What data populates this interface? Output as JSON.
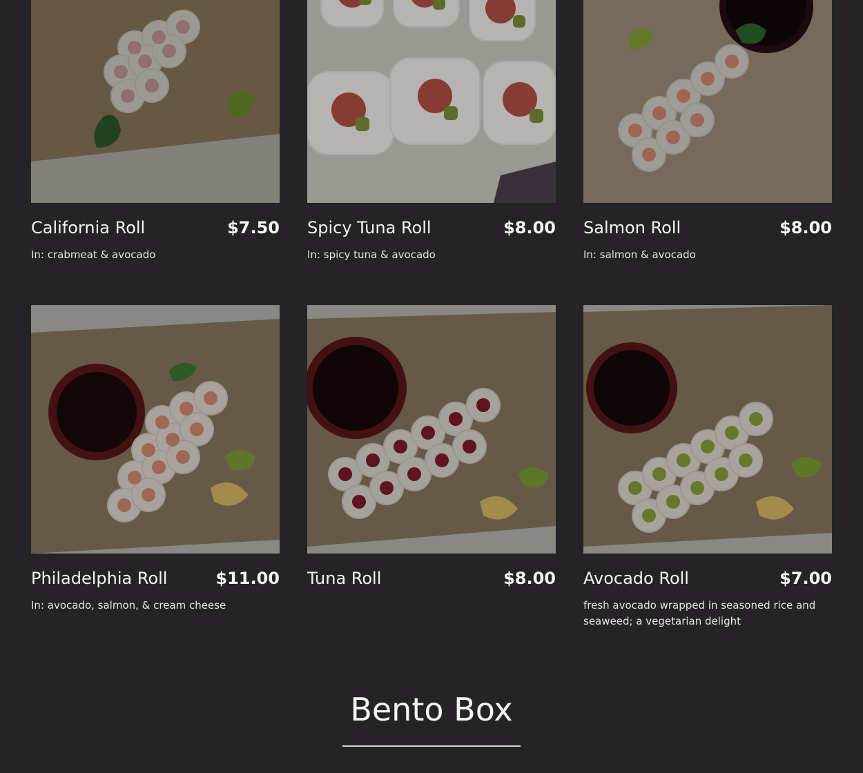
{
  "menu_items": [
    {
      "name": "California Roll",
      "price": "$7.50",
      "description": "In: crabmeat & avocado",
      "photo": "sushi-photo"
    },
    {
      "name": "Spicy Tuna Roll",
      "price": "$8.00",
      "description": "In: spicy tuna & avocado",
      "photo": "sushi-photo"
    },
    {
      "name": "Salmon Roll",
      "price": "$8.00",
      "description": "In: salmon & avocado",
      "photo": "sushi-photo"
    },
    {
      "name": "Philadelphia Roll",
      "price": "$11.00",
      "description": "In: avocado, salmon, & cream cheese",
      "photo": "sushi-photo"
    },
    {
      "name": "Tuna Roll",
      "price": "$8.00",
      "description": "",
      "photo": "sushi-photo"
    },
    {
      "name": "Avocado Roll",
      "price": "$7.00",
      "description": "fresh avocado wrapped in seasoned rice and seaweed; a vegetarian delight",
      "photo": "sushi-photo"
    }
  ],
  "section": {
    "title": "Bento Box"
  },
  "colors": {
    "background": "#252325",
    "text": "#f4f4f4",
    "rule": "#d9d9d9"
  }
}
